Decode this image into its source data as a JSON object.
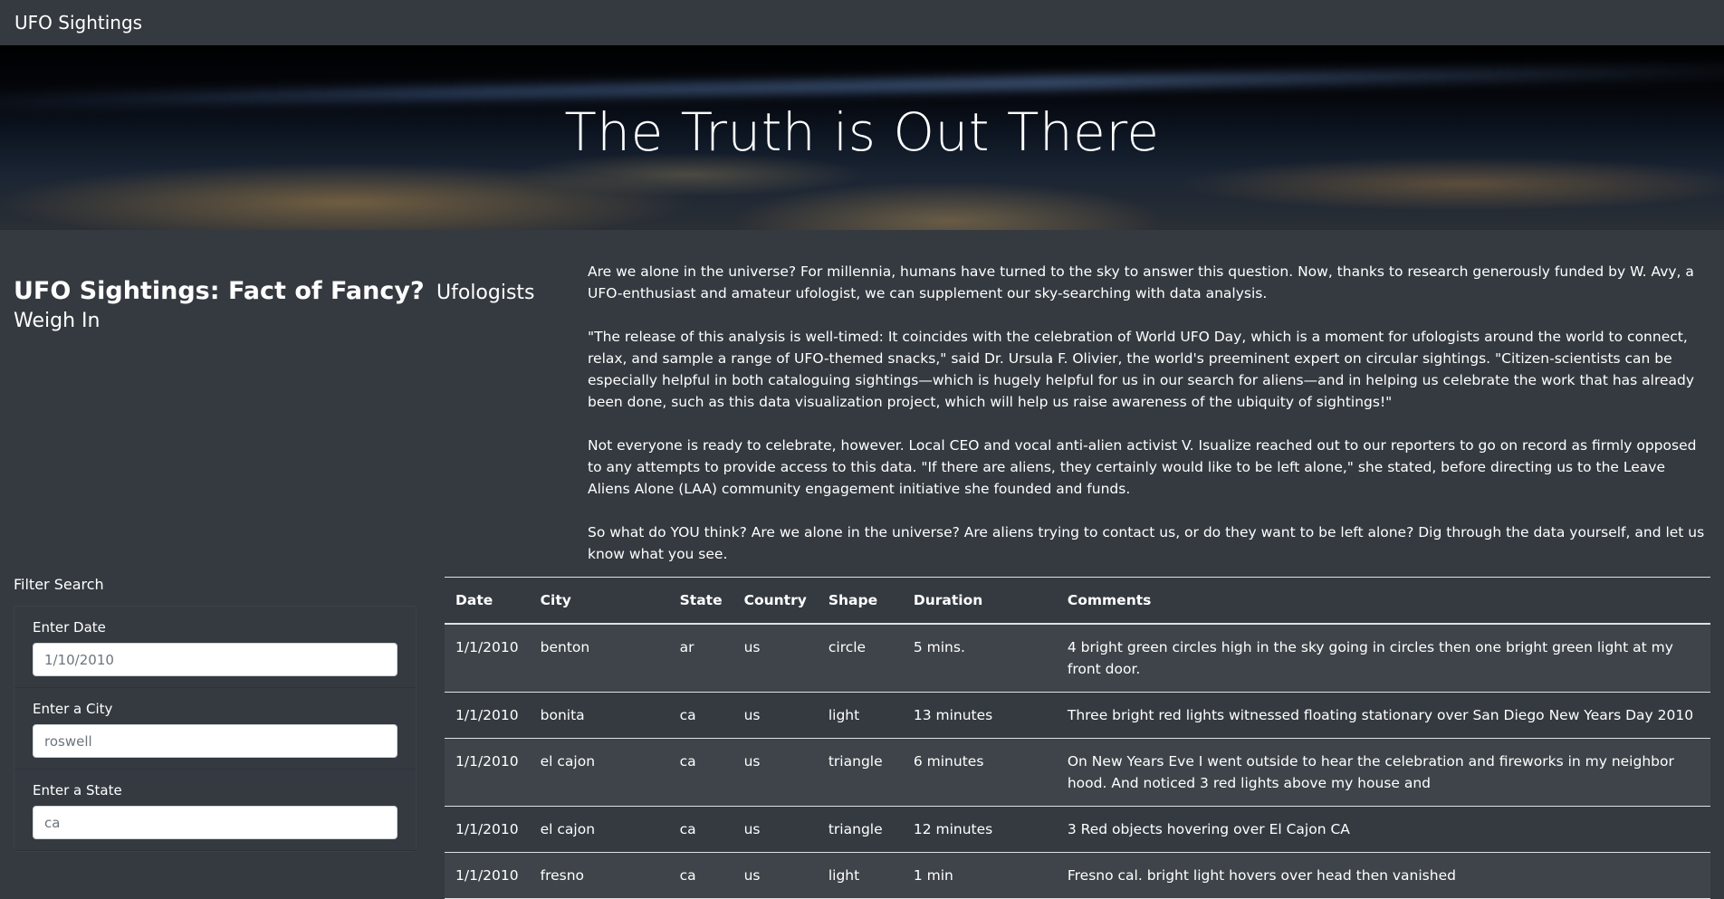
{
  "navbar": {
    "brand": "UFO Sightings"
  },
  "hero": {
    "title": "The Truth is Out There"
  },
  "intro": {
    "headline": "UFO Sightings: Fact of Fancy?",
    "subheadline": "Ufologists Weigh In",
    "paragraphs": [
      "Are we alone in the universe? For millennia, humans have turned to the sky to answer this question. Now, thanks to research generously funded by W. Avy, a UFO-enthusiast and amateur ufologist, we can supplement our sky-searching with data analysis.",
      "\"The release of this analysis is well-timed: It coincides with the celebration of World UFO Day, which is a moment for ufologists around the world to connect, relax, and sample a range of UFO-themed snacks,\" said Dr. Ursula F. Olivier, the world's preeminent expert on circular sightings. \"Citizen-scientists can be especially helpful in both cataloguing sightings—which is hugely helpful for us in our search for aliens—and in helping us celebrate the work that has already been done, such as this data visualization project, which will help us raise awareness of the ubiquity of sightings!\"",
      "Not everyone is ready to celebrate, however. Local CEO and vocal anti-alien activist V. Isualize reached out to our reporters to go on record as firmly opposed to any attempts to provide access to this data. \"If there are aliens, they certainly would like to be left alone,\" she stated, before directing us to the Leave Aliens Alone (LAA) community engagement initiative she founded and funds.",
      "So what do YOU think? Are we alone in the universe? Are aliens trying to contact us, or do they want to be left alone? Dig through the data yourself, and let us know what you see."
    ]
  },
  "filter": {
    "title": "Filter Search",
    "fields": [
      {
        "label": "Enter Date",
        "placeholder": "1/10/2010"
      },
      {
        "label": "Enter a City",
        "placeholder": "roswell"
      },
      {
        "label": "Enter a State",
        "placeholder": "ca"
      }
    ]
  },
  "table": {
    "headers": [
      "Date",
      "City",
      "State",
      "Country",
      "Shape",
      "Duration",
      "Comments"
    ],
    "rows": [
      [
        "1/1/2010",
        "benton",
        "ar",
        "us",
        "circle",
        "5 mins.",
        "4 bright green circles high in the sky going in circles then one bright green light at my front door."
      ],
      [
        "1/1/2010",
        "bonita",
        "ca",
        "us",
        "light",
        "13 minutes",
        "Three bright red lights witnessed floating stationary over San Diego New Years Day 2010"
      ],
      [
        "1/1/2010",
        "el cajon",
        "ca",
        "us",
        "triangle",
        "6 minutes",
        "On New Years Eve I went outside to hear the celebration and fireworks in my neighbor hood. And noticed 3 red lights above my house and"
      ],
      [
        "1/1/2010",
        "el cajon",
        "ca",
        "us",
        "triangle",
        "12 minutes",
        "3 Red objects hovering over El Cajon CA"
      ],
      [
        "1/1/2010",
        "fresno",
        "ca",
        "us",
        "light",
        "1 min",
        "Fresno cal. bright light hovers over head then vanished"
      ]
    ]
  }
}
